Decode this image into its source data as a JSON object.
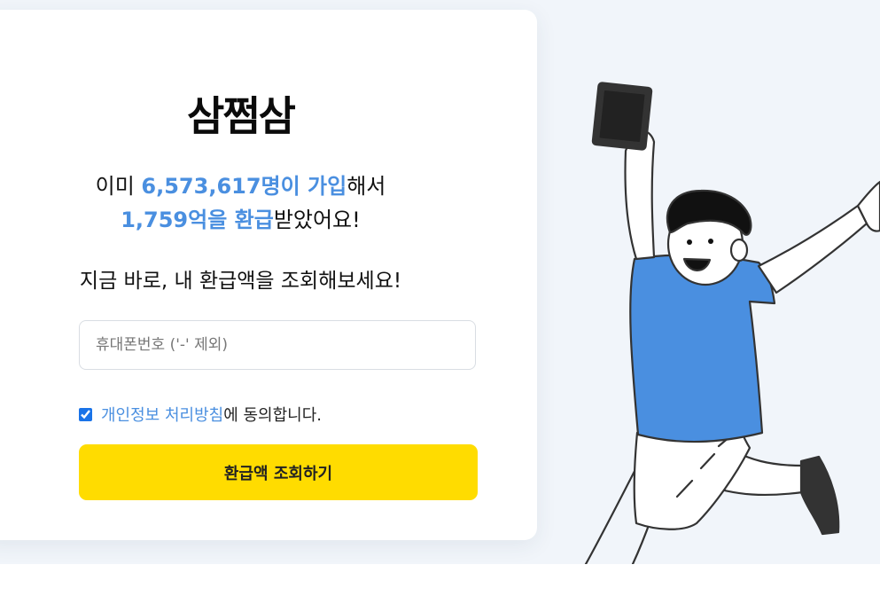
{
  "brand": {
    "logo": "삼쩜삼"
  },
  "stats": {
    "line1_prefix": "이미 ",
    "line1_highlight": "6,573,617명이 가입",
    "line1_suffix": "해서",
    "line2_highlight": "1,759억을 환급",
    "line2_suffix": "받았어요!"
  },
  "cta": {
    "text": "지금 바로, 내 환급액을 조회해보세요!"
  },
  "form": {
    "phone_placeholder": "휴대폰번호 ('-' 제외)",
    "agree_link": "개인정보 처리방침",
    "agree_suffix": "에 동의합니다.",
    "agree_checked": true,
    "submit_label": "환급액 조회하기"
  },
  "colors": {
    "accent": "#4a8fe0",
    "button": "#ffdc00",
    "shirt": "#4a8fe0"
  }
}
